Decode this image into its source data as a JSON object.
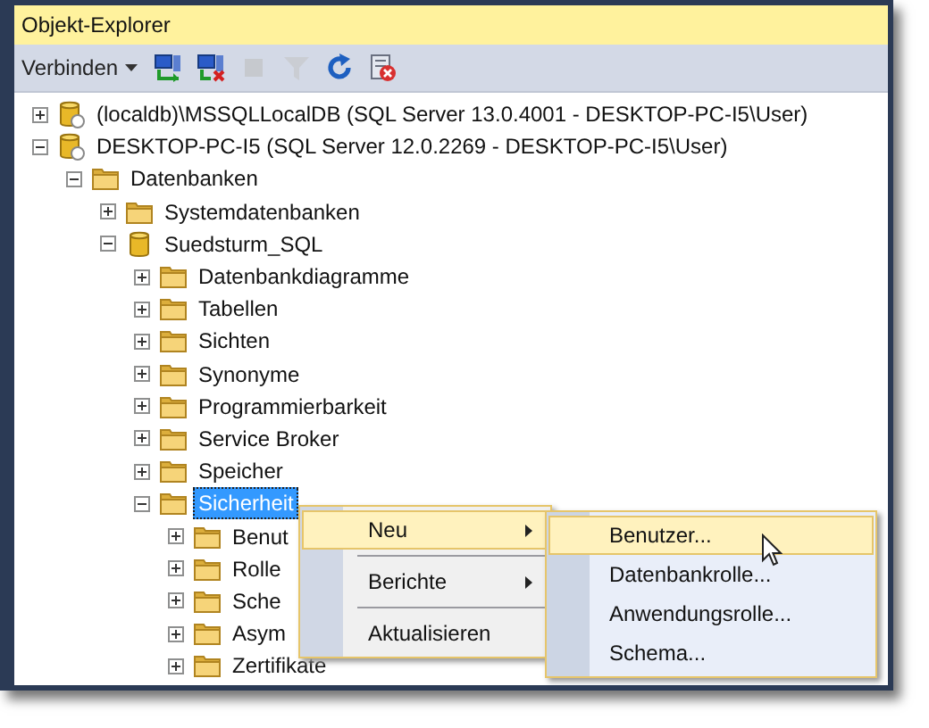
{
  "panel": {
    "title": "Objekt-Explorer"
  },
  "toolbar": {
    "connect": {
      "label": "Verbinden"
    },
    "tools": [
      {
        "kind": "connect",
        "disabled": false
      },
      {
        "kind": "disconnect",
        "disabled": false
      },
      {
        "kind": "stop",
        "disabled": true
      },
      {
        "kind": "filter",
        "disabled": true
      },
      {
        "kind": "refresh",
        "disabled": false
      },
      {
        "kind": "monitor",
        "disabled": false
      }
    ]
  },
  "tree": [
    {
      "label": "(localdb)\\MSSQLLocalDB (SQL Server 13.0.4001 - DESKTOP-PC-I5\\User)",
      "kind": "server",
      "expanded": false,
      "selected": false
    },
    {
      "label": "DESKTOP-PC-I5 (SQL Server 12.0.2269 - DESKTOP-PC-I5\\User)",
      "kind": "server",
      "expanded": true,
      "selected": false,
      "children": [
        {
          "label": "Datenbanken",
          "kind": "folder",
          "expanded": true,
          "selected": false,
          "children": [
            {
              "label": "Systemdatenbanken",
              "kind": "folder",
              "expanded": false,
              "selected": false
            },
            {
              "label": "Suedsturm_SQL",
              "kind": "database",
              "expanded": true,
              "selected": false,
              "children": [
                {
                  "label": "Datenbankdiagramme",
                  "kind": "folder",
                  "expanded": false,
                  "selected": false
                },
                {
                  "label": "Tabellen",
                  "kind": "folder",
                  "expanded": false,
                  "selected": false
                },
                {
                  "label": "Sichten",
                  "kind": "folder",
                  "expanded": false,
                  "selected": false
                },
                {
                  "label": "Synonyme",
                  "kind": "folder",
                  "expanded": false,
                  "selected": false
                },
                {
                  "label": "Programmierbarkeit",
                  "kind": "folder",
                  "expanded": false,
                  "selected": false
                },
                {
                  "label": "Service Broker",
                  "kind": "folder",
                  "expanded": false,
                  "selected": false
                },
                {
                  "label": "Speicher",
                  "kind": "folder",
                  "expanded": false,
                  "selected": false
                },
                {
                  "label": "Sicherheit",
                  "kind": "folder",
                  "expanded": true,
                  "selected": true,
                  "children": [
                    {
                      "label": "Benut",
                      "kind": "folder",
                      "expanded": false,
                      "selected": false
                    },
                    {
                      "label": "Rolle",
                      "kind": "folder",
                      "expanded": false,
                      "selected": false
                    },
                    {
                      "label": "Sche",
                      "kind": "folder",
                      "expanded": false,
                      "selected": false
                    },
                    {
                      "label": "Asym",
                      "kind": "folder",
                      "expanded": false,
                      "selected": false
                    },
                    {
                      "label": "Zertifikate",
                      "kind": "folder",
                      "expanded": false,
                      "selected": false
                    }
                  ]
                }
              ]
            }
          ]
        }
      ]
    }
  ],
  "context_menu": {
    "items": [
      {
        "kind": "item",
        "label": "Neu",
        "submenu": true,
        "selected": true
      },
      {
        "kind": "separator"
      },
      {
        "kind": "item",
        "label": "Berichte",
        "submenu": true,
        "selected": false
      },
      {
        "kind": "separator"
      },
      {
        "kind": "item",
        "label": "Aktualisieren",
        "submenu": false,
        "selected": false
      }
    ]
  },
  "submenu": {
    "items": [
      {
        "label": "Benutzer...",
        "selected": true
      },
      {
        "label": "Datenbankrolle...",
        "selected": false
      },
      {
        "label": "Anwendungsrolle...",
        "selected": false
      },
      {
        "label": "Schema...",
        "selected": false
      }
    ]
  }
}
